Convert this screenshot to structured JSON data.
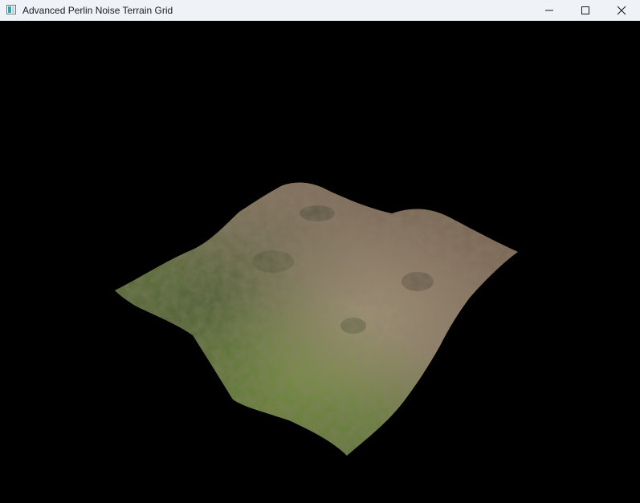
{
  "window": {
    "title": "Advanced Perlin Noise Terrain Grid",
    "app_icon": "window-app-icon",
    "controls": {
      "minimize_icon": "minimize-icon",
      "maximize_icon": "maximize-icon",
      "close_icon": "close-icon"
    }
  },
  "viewport": {
    "background_color": "#000000",
    "scene": "textured-terrain-mesh",
    "terrain_colors": {
      "grass": "#5c7a36",
      "dirt": "#8a735c",
      "rock": "#6f5d4c",
      "shadow": "#3e4330"
    }
  }
}
